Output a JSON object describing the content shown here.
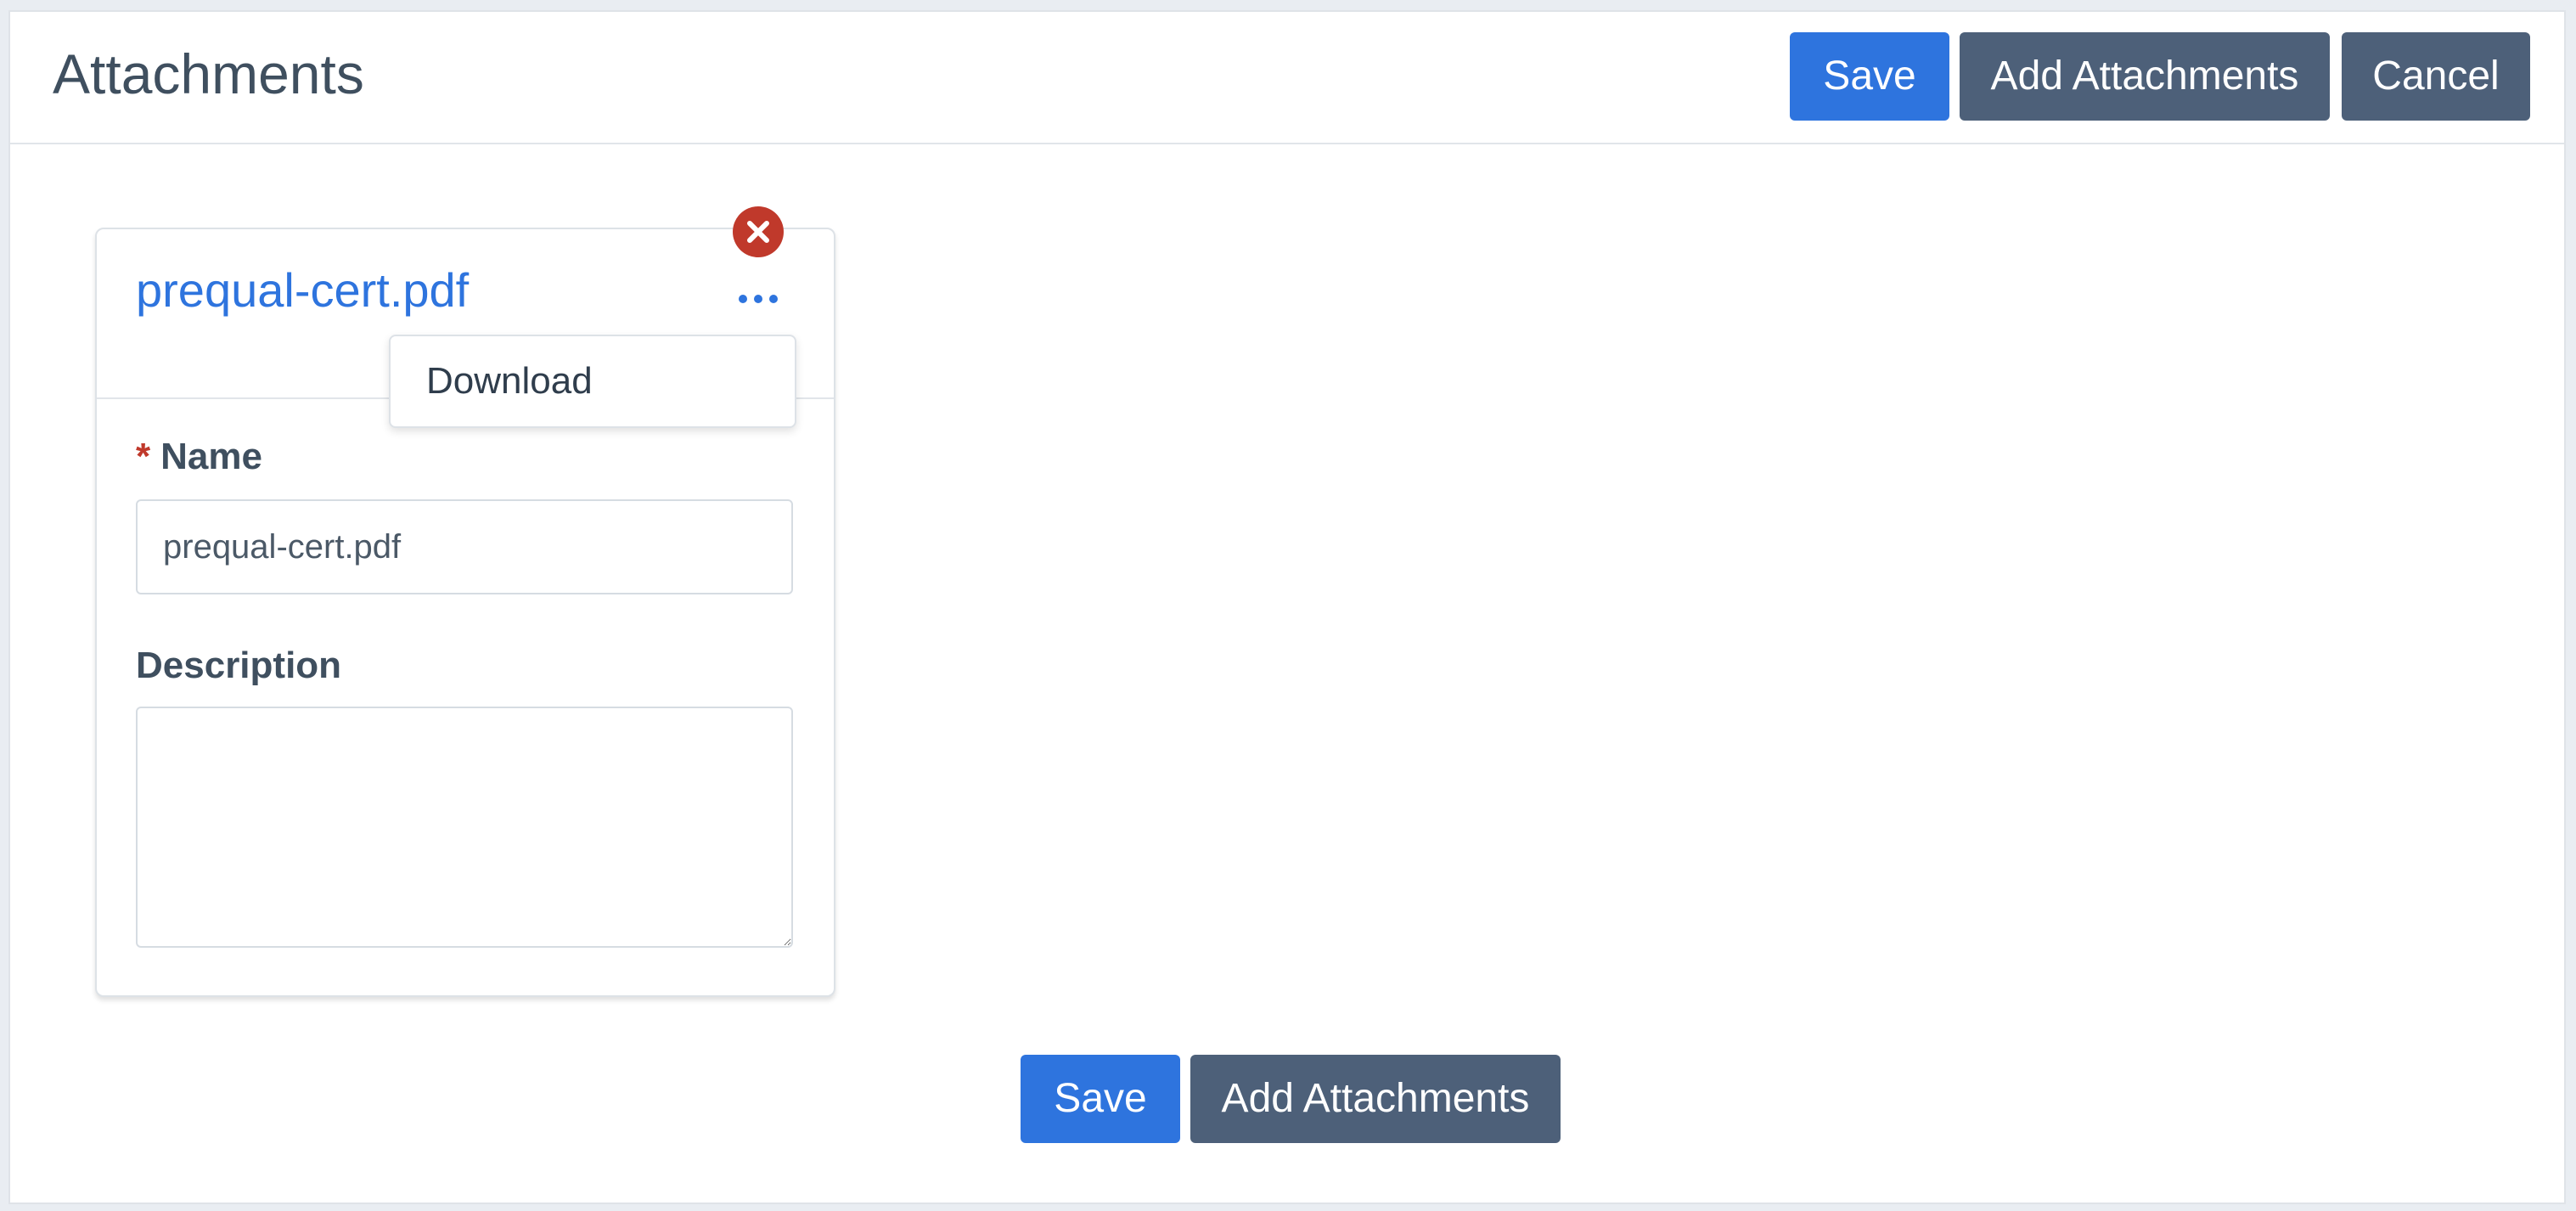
{
  "header": {
    "title": "Attachments",
    "save_label": "Save",
    "add_label": "Add Attachments",
    "cancel_label": "Cancel"
  },
  "attachment": {
    "file_name": "prequal-cert.pdf",
    "menu": {
      "items": [
        "Download"
      ]
    },
    "name_field": {
      "required_mark": "*",
      "label": "Name",
      "value": "prequal-cert.pdf"
    },
    "description_field": {
      "label": "Description",
      "value": ""
    }
  },
  "footer": {
    "save_label": "Save",
    "add_label": "Add Attachments"
  },
  "icons": {
    "more": "more-horizontal-icon",
    "remove": "close-circle-icon"
  },
  "colors": {
    "primary": "#2e74de",
    "secondary": "#4d6079",
    "danger": "#c0392b",
    "text": "#3f4f5f"
  }
}
